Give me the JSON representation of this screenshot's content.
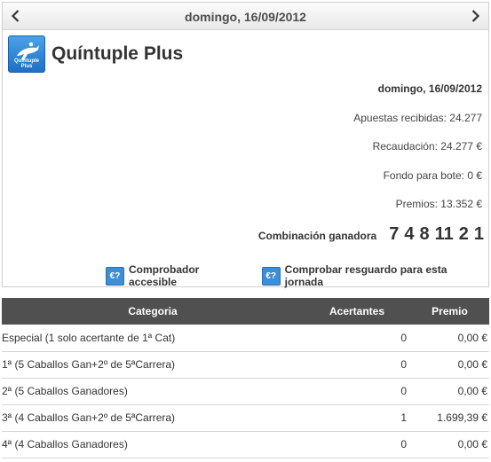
{
  "nav": {
    "date": "domingo, 16/09/2012"
  },
  "game": {
    "logo_text": "Quíntuple Plus",
    "title": "Quíntuple Plus"
  },
  "stats": {
    "date": "domingo, 16/09/2012",
    "apuestas": "Apuestas recibidas: 24.277",
    "recaudacion": "Recaudación: 24.277 €",
    "fondo": "Fondo para bote: 0 €",
    "premios": "Premios: 13.352 €"
  },
  "combination": {
    "label": "Combinación ganadora",
    "numbers": [
      "7",
      "4",
      "8",
      "11",
      "2",
      "1"
    ]
  },
  "links": {
    "icon_text": "€?",
    "accesible": "Comprobador accesible",
    "resguardo": "Comprobar resguardo para esta jornada"
  },
  "table": {
    "headers": [
      "Categoria",
      "Acertantes",
      "Premio"
    ],
    "rows": [
      [
        "Especial (1 solo acertante de 1ª Cat)",
        "0",
        "0,00 €"
      ],
      [
        "1ª (5 Caballos Gan+2º de 5ªCarrera)",
        "0",
        "0,00 €"
      ],
      [
        "2ª (5 Caballos Ganadores)",
        "0",
        "0,00 €"
      ],
      [
        "3ª (4 Caballos Gan+2º de 5ªCarrera)",
        "1",
        "1.699,39 €"
      ],
      [
        "4ª (4 Caballos Ganadores)",
        "0",
        "0,00 €"
      ]
    ]
  },
  "colors": {
    "header_bg": "#505050",
    "logo_blue": "#1f6fc5",
    "icon_blue": "#3c8fd6"
  }
}
